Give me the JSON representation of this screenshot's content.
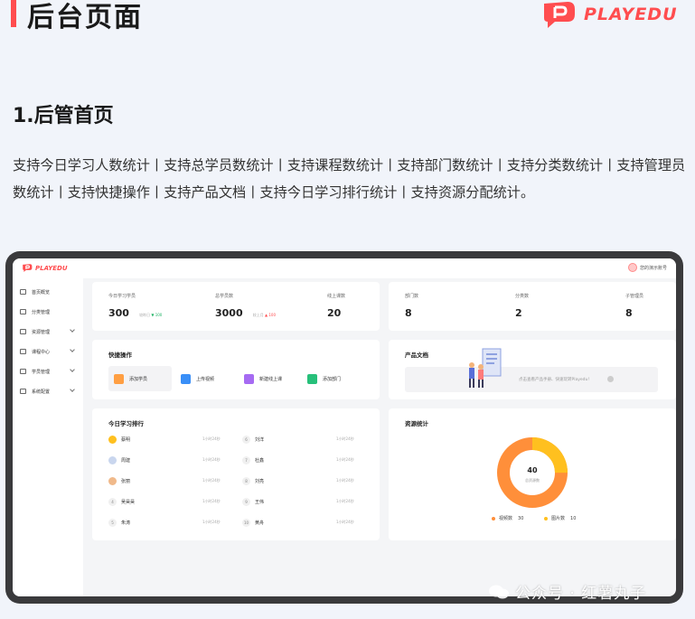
{
  "poster": {
    "title": "后台页面",
    "brand": "PLAYEDU",
    "section_title": "1.后管首页",
    "description": "支持今日学习人数统计丨支持总学员数统计丨支持课程数统计丨支持部门数统计丨支持分类数统计丨支持管理员数统计丨支持快捷操作丨支持产品文档丨支持今日学习排行统计丨支持资源分配统计。",
    "watermark": "公众号 · 红薯丸子"
  },
  "app": {
    "brand": "PLAYEDU",
    "user_name": "您的演示账号",
    "accent": "#ff4d4f",
    "sidebar": [
      {
        "label": "首页概览",
        "icon": "home-icon"
      },
      {
        "label": "分类管理",
        "icon": "category-icon"
      },
      {
        "label": "资源管理",
        "icon": "folder-icon"
      },
      {
        "label": "课程中心",
        "icon": "course-icon"
      },
      {
        "label": "学员管理",
        "icon": "user-icon"
      },
      {
        "label": "系统配置",
        "icon": "settings-icon"
      }
    ],
    "stats_left": [
      {
        "label": "今日学习学员",
        "value": "300",
        "sub": "较昨日",
        "change": "▼ 100"
      },
      {
        "label": "总学员数",
        "value": "3000",
        "sub": "较上月",
        "change": "▲ 100"
      },
      {
        "label": "线上课数",
        "value": "20"
      }
    ],
    "stats_right": [
      {
        "label": "部门数",
        "value": "8"
      },
      {
        "label": "分类数",
        "value": "2"
      },
      {
        "label": "子管理员",
        "value": "8"
      }
    ],
    "quick_actions": {
      "title": "快捷操作",
      "items": [
        {
          "label": "添加学员",
          "color": "#ff9f43"
        },
        {
          "label": "上传视频",
          "color": "#3a8ff7"
        },
        {
          "label": "新建线上课",
          "color": "#a66bf2"
        },
        {
          "label": "添加部门",
          "color": "#27c07a"
        }
      ]
    },
    "docs": {
      "title": "产品文档",
      "text": "点击查看产品手册、快速玩转Playedu!"
    },
    "ranking": {
      "title": "今日学习排行",
      "left": [
        {
          "rank": "1",
          "name": "蔡明",
          "time": "1小时24秒"
        },
        {
          "rank": "2",
          "name": "周建",
          "time": "1小时24秒"
        },
        {
          "rank": "3",
          "name": "张丽",
          "time": "1小时24秒"
        },
        {
          "rank": "4",
          "name": "吴昊昊",
          "time": "1小时24秒"
        },
        {
          "rank": "5",
          "name": "朱涛",
          "time": "1小时24秒"
        }
      ],
      "right": [
        {
          "rank": "6",
          "name": "刘洋",
          "time": "1小时24秒"
        },
        {
          "rank": "7",
          "name": "杜鑫",
          "time": "1小时24秒"
        },
        {
          "rank": "8",
          "name": "刘亮",
          "time": "1小时24秒"
        },
        {
          "rank": "9",
          "name": "王伟",
          "time": "1小时24秒"
        },
        {
          "rank": "10",
          "name": "黄舟",
          "time": "1小时24秒"
        }
      ]
    },
    "resources": {
      "title": "资源统计",
      "total": "40",
      "total_label": "总资源数",
      "items": [
        {
          "label": "视频数",
          "value": "30",
          "color": "#ff8f3a"
        },
        {
          "label": "图片数",
          "value": "10",
          "color": "#ffc01f"
        }
      ]
    }
  }
}
